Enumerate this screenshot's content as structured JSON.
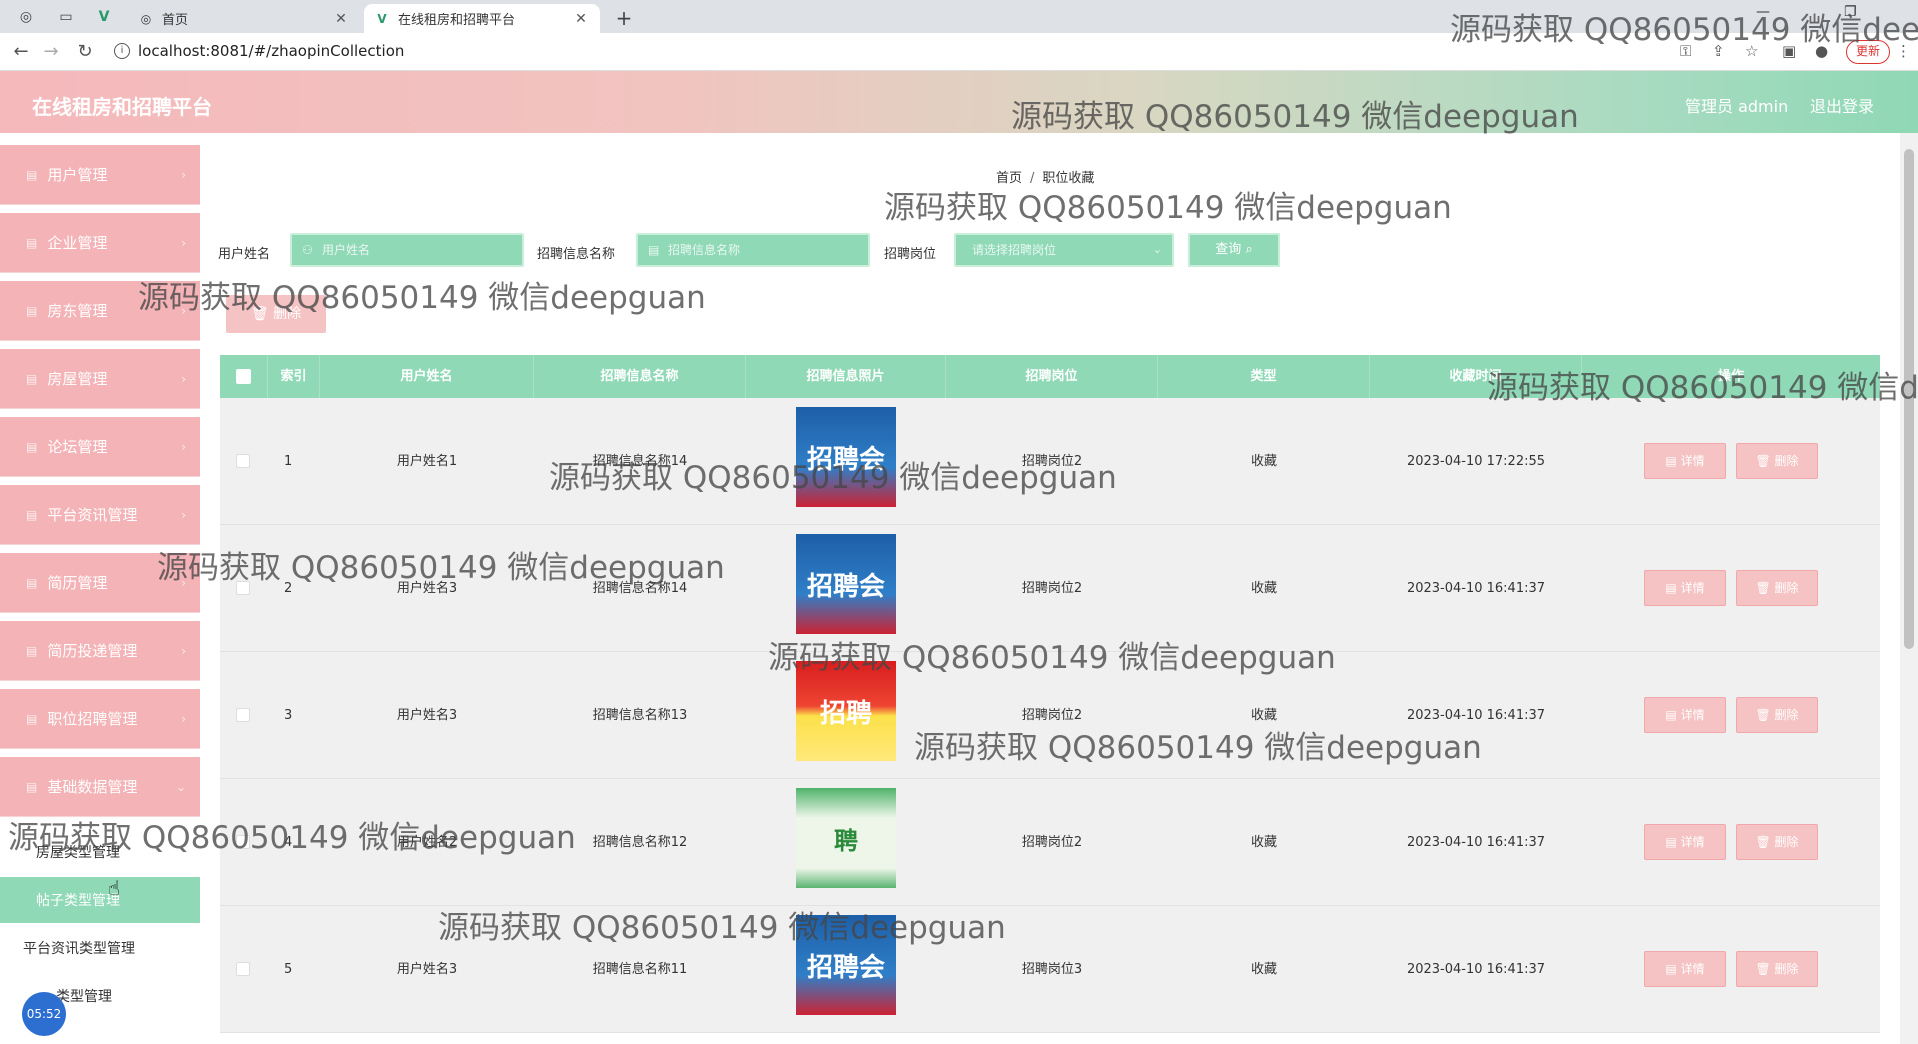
{
  "browser": {
    "tabs": [
      {
        "title": "首页"
      },
      {
        "title": "在线租房和招聘平台"
      }
    ],
    "url": "localhost:8081/#/zhaopinCollection",
    "update_label": "更新"
  },
  "header": {
    "app_title": "在线租房和招聘平台",
    "admin_label": "管理员 admin",
    "logout_label": "退出登录"
  },
  "sidebar": {
    "menus": [
      {
        "label": "用户管理"
      },
      {
        "label": "企业管理"
      },
      {
        "label": "房东管理"
      },
      {
        "label": "房屋管理"
      },
      {
        "label": "论坛管理"
      },
      {
        "label": "平台资讯管理"
      },
      {
        "label": "简历管理"
      },
      {
        "label": "简历投递管理"
      },
      {
        "label": "职位招聘管理"
      },
      {
        "label": "基础数据管理"
      }
    ],
    "subitems": [
      {
        "label": "房屋类型管理"
      },
      {
        "label": "帖子类型管理"
      },
      {
        "label": "平台资讯类型管理"
      },
      {
        "label": "类型管理"
      }
    ],
    "clock": "05:52"
  },
  "main": {
    "breadcrumb": {
      "home": "首页",
      "current": "职位收藏"
    },
    "filters": {
      "user_name_label": "用户姓名",
      "user_name_placeholder": "用户姓名",
      "info_name_label": "招聘信息名称",
      "info_name_placeholder": "招聘信息名称",
      "position_label": "招聘岗位",
      "position_placeholder": "请选择招聘岗位",
      "query_label": "查询"
    },
    "delete_batch_label": "删除",
    "table": {
      "headers": [
        "索引",
        "用户姓名",
        "招聘信息名称",
        "招聘信息照片",
        "招聘岗位",
        "类型",
        "收藏时间",
        "操作"
      ],
      "rows": [
        {
          "index": "1",
          "user": "用户姓名1",
          "info": "招聘信息名称14",
          "position": "招聘岗位2",
          "type": "收藏",
          "time": "2023-04-10 17:22:55",
          "poster": "blue",
          "poster_text": "招聘会"
        },
        {
          "index": "2",
          "user": "用户姓名3",
          "info": "招聘信息名称14",
          "position": "招聘岗位2",
          "type": "收藏",
          "time": "2023-04-10 16:41:37",
          "poster": "blue",
          "poster_text": "招聘会"
        },
        {
          "index": "3",
          "user": "用户姓名3",
          "info": "招聘信息名称13",
          "position": "招聘岗位2",
          "type": "收藏",
          "time": "2023-04-10 16:41:37",
          "poster": "red",
          "poster_text": "招聘"
        },
        {
          "index": "4",
          "user": "用户姓名2",
          "info": "招聘信息名称12",
          "position": "招聘岗位2",
          "type": "收藏",
          "time": "2023-04-10 16:41:37",
          "poster": "green",
          "poster_text": "聘"
        },
        {
          "index": "5",
          "user": "用户姓名3",
          "info": "招聘信息名称11",
          "position": "招聘岗位3",
          "type": "收藏",
          "time": "2023-04-10 16:41:37",
          "poster": "blue",
          "poster_text": "招聘会"
        }
      ],
      "detail_label": "详情",
      "delete_label": "删除"
    }
  },
  "watermark": "源码获取 QQ86050149 微信deepguan",
  "colors": {
    "accent_green": "#8fd9b6",
    "accent_pink": "#f4b3b6"
  }
}
